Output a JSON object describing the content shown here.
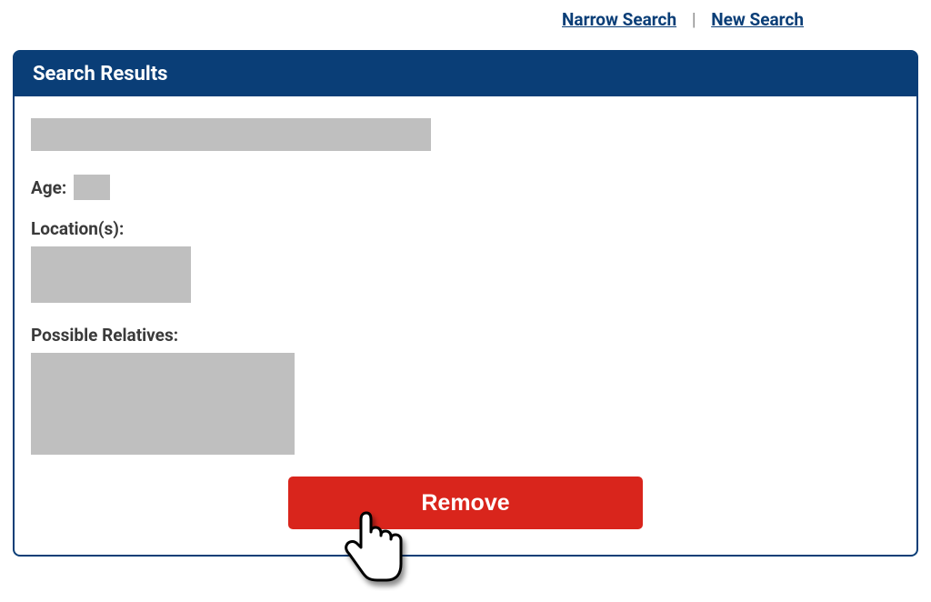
{
  "header": {
    "narrow_search": "Narrow Search",
    "new_search": "New Search",
    "divider": "|"
  },
  "panel": {
    "title": "Search Results",
    "age_label": "Age:",
    "locations_label": "Location(s):",
    "relatives_label": "Possible Relatives:",
    "remove_button": "Remove"
  }
}
